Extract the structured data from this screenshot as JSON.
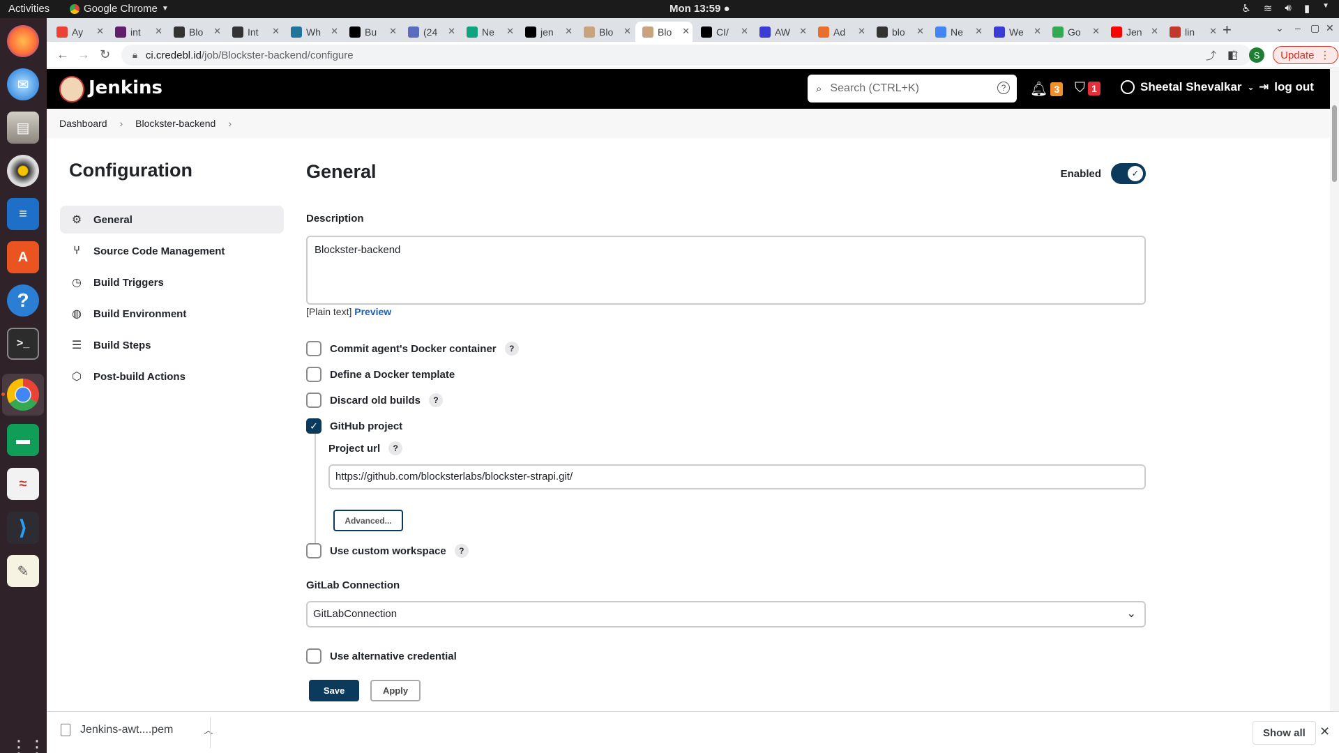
{
  "os": {
    "activities": "Activities",
    "app_name": "Google Chrome",
    "clock": "Mon 13:59"
  },
  "dock": {
    "apps": [
      "firefox",
      "thunderbird",
      "files",
      "rhythmbox",
      "writer",
      "software",
      "help",
      "terminal",
      "chrome",
      "chat",
      "evince",
      "vscode",
      "text-editor"
    ]
  },
  "browser": {
    "tabs": [
      {
        "label": "Ay",
        "icon": "gmail-icon",
        "color": "#ea4335"
      },
      {
        "label": "int",
        "icon": "slack-icon",
        "color": "#611f69"
      },
      {
        "label": "Blo",
        "icon": "github-icon",
        "color": "#333333"
      },
      {
        "label": "Int",
        "icon": "github-icon",
        "color": "#333333"
      },
      {
        "label": "Wh",
        "icon": "wordpress-icon",
        "color": "#21759b"
      },
      {
        "label": "Bu",
        "icon": "dev-icon",
        "color": "#000000"
      },
      {
        "label": "(24",
        "icon": "app-icon",
        "color": "#5b6bbf"
      },
      {
        "label": "Ne",
        "icon": "chatgpt-icon",
        "color": "#10a37f"
      },
      {
        "label": "jen",
        "icon": "notion-icon",
        "color": "#000000"
      },
      {
        "label": "Blo",
        "icon": "jenkins-icon",
        "color": "#c9a27e"
      },
      {
        "label": "Blo",
        "icon": "jenkins-icon",
        "color": "#c9a27e"
      },
      {
        "label": "CI/",
        "icon": "medium-icon",
        "color": "#000000"
      },
      {
        "label": "AW",
        "icon": "app-icon",
        "color": "#3b3bd6"
      },
      {
        "label": "Ad",
        "icon": "app-icon",
        "color": "#e8702a"
      },
      {
        "label": "blo",
        "icon": "github-icon",
        "color": "#333333"
      },
      {
        "label": "Ne",
        "icon": "chrome-icon",
        "color": "#4285f4"
      },
      {
        "label": "We",
        "icon": "app-icon",
        "color": "#3b3bd6"
      },
      {
        "label": "Go",
        "icon": "google-icon",
        "color": "#34a853"
      },
      {
        "label": "Jen",
        "icon": "youtube-icon",
        "color": "#ff0000"
      },
      {
        "label": "lin",
        "icon": "app-icon",
        "color": "#c0392b"
      }
    ],
    "active_tab": 10,
    "url_host": "ci.credebl.id",
    "url_path": "/job/Blockster-backend/configure",
    "profile_initial": "S",
    "update_label": "Update"
  },
  "jenkins": {
    "brand": "Jenkins",
    "search_placeholder": "Search (CTRL+K)",
    "notifications_count": "3",
    "security_count": "1",
    "user_name": "Sheetal Shevalkar",
    "logout_label": "log out",
    "breadcrumbs": [
      "Dashboard",
      "Blockster-backend"
    ]
  },
  "sidebar": {
    "title": "Configuration",
    "items": [
      {
        "label": "General",
        "icon": "gear-icon",
        "active": true
      },
      {
        "label": "Source Code Management",
        "icon": "branch-icon",
        "active": false
      },
      {
        "label": "Build Triggers",
        "icon": "clock-icon",
        "active": false
      },
      {
        "label": "Build Environment",
        "icon": "globe-icon",
        "active": false
      },
      {
        "label": "Build Steps",
        "icon": "list-icon",
        "active": false
      },
      {
        "label": "Post-build Actions",
        "icon": "cube-icon",
        "active": false
      }
    ]
  },
  "general": {
    "title": "General",
    "enabled_label": "Enabled",
    "enabled": true,
    "description_label": "Description",
    "description_value": "Blockster-backend",
    "plain_text": "[Plain text]",
    "preview_label": "Preview",
    "options": [
      {
        "label": "Commit agent's Docker container",
        "checked": false,
        "help": "?"
      },
      {
        "label": "Define a Docker template",
        "checked": false,
        "help": ""
      },
      {
        "label": "Discard old builds",
        "checked": false,
        "help": "?"
      },
      {
        "label": "GitHub project",
        "checked": true,
        "help": ""
      }
    ],
    "project_url_label": "Project url",
    "project_url_help": "?",
    "project_url_value": "https://github.com/blocksterlabs/blockster-strapi.git/",
    "advanced_label": "Advanced...",
    "custom_workspace_label": "Use custom workspace",
    "custom_workspace_help": "?",
    "gitlab_label": "GitLab Connection",
    "gitlab_value": "GitLabConnection",
    "alt_credential_label": "Use alternative credential"
  },
  "actions": {
    "save_label": "Save",
    "apply_label": "Apply"
  },
  "downloads": {
    "file_name": "Jenkins-awt....pem",
    "show_all_label": "Show all"
  },
  "colors": {
    "jenkins_header": "#000000",
    "primary_button": "#0b3a5c",
    "link": "#1a5fb4",
    "notif_badge": "#f0902b",
    "security_badge": "#e5303a"
  }
}
